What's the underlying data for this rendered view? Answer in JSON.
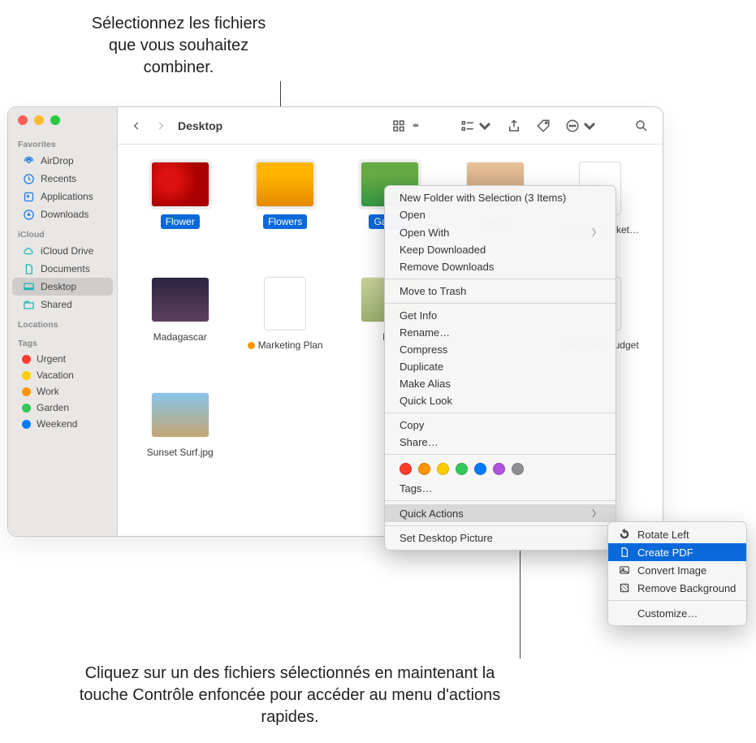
{
  "callouts": {
    "top": "Sélectionnez les fichiers que vous souhaitez combiner.",
    "bottom": "Cliquez sur un des fichiers sélectionnés en maintenant la touche Contrôle enfoncée pour accéder au menu d'actions rapides."
  },
  "window": {
    "title": "Desktop"
  },
  "sidebar": {
    "sections": {
      "favorites": {
        "heading": "Favorites",
        "items": [
          "AirDrop",
          "Recents",
          "Applications",
          "Downloads"
        ]
      },
      "icloud": {
        "heading": "iCloud",
        "items": [
          "iCloud Drive",
          "Documents",
          "Desktop",
          "Shared"
        ]
      },
      "locations": {
        "heading": "Locations"
      },
      "tags_heading": "Tags",
      "tags": [
        {
          "label": "Urgent",
          "color": "#ff3b30"
        },
        {
          "label": "Vacation",
          "color": "#ffcc00"
        },
        {
          "label": "Work",
          "color": "#ff9500"
        },
        {
          "label": "Garden",
          "color": "#34c759"
        },
        {
          "label": "Weekend",
          "color": "#007aff"
        }
      ]
    }
  },
  "files": [
    {
      "name": "Flower",
      "selected": true,
      "thumb": "t-flower"
    },
    {
      "name": "Flowers",
      "selected": true,
      "thumb": "t-flowers"
    },
    {
      "name": "Garden",
      "selected": true,
      "thumb": "t-garden",
      "truncated": "Gard"
    },
    {
      "name": "Market",
      "thumb": "t-market",
      "truncated": "rket"
    },
    {
      "name": "Farmers Market Poster",
      "thumb": "t-poster",
      "doc": true,
      "truncated": "ter"
    },
    {
      "name": "Madagascar",
      "thumb": "t-mad"
    },
    {
      "name": "Marketing Plan",
      "thumb": "t-mplan",
      "doc": true,
      "tag": "#ff9500"
    },
    {
      "name": "Nat",
      "thumb": "t-nat",
      "truncated": "Na"
    },
    {
      "name": "Corporate Budget",
      "thumb": "t-budget",
      "doc": true,
      "truncated": "te\nt"
    },
    {
      "name": "Sunset Surf.jpg",
      "thumb": "t-surf"
    }
  ],
  "ctx": {
    "new_folder": "New Folder with Selection (3 Items)",
    "open": "Open",
    "open_with": "Open With",
    "keep_downloaded": "Keep Downloaded",
    "remove_downloads": "Remove Downloads",
    "move_to_trash": "Move to Trash",
    "get_info": "Get Info",
    "rename": "Rename…",
    "compress": "Compress",
    "duplicate": "Duplicate",
    "make_alias": "Make Alias",
    "quick_look": "Quick Look",
    "copy": "Copy",
    "share": "Share…",
    "tags": "Tags…",
    "quick_actions": "Quick Actions",
    "set_desktop": "Set Desktop Picture",
    "tag_colors": [
      "#ff3b30",
      "#ff9500",
      "#ffcc00",
      "#34c759",
      "#007aff",
      "#af52de",
      "#8e8e93"
    ]
  },
  "submenu": {
    "rotate_left": "Rotate Left",
    "create_pdf": "Create PDF",
    "convert_image": "Convert Image",
    "remove_bg": "Remove Background",
    "customize": "Customize…"
  }
}
